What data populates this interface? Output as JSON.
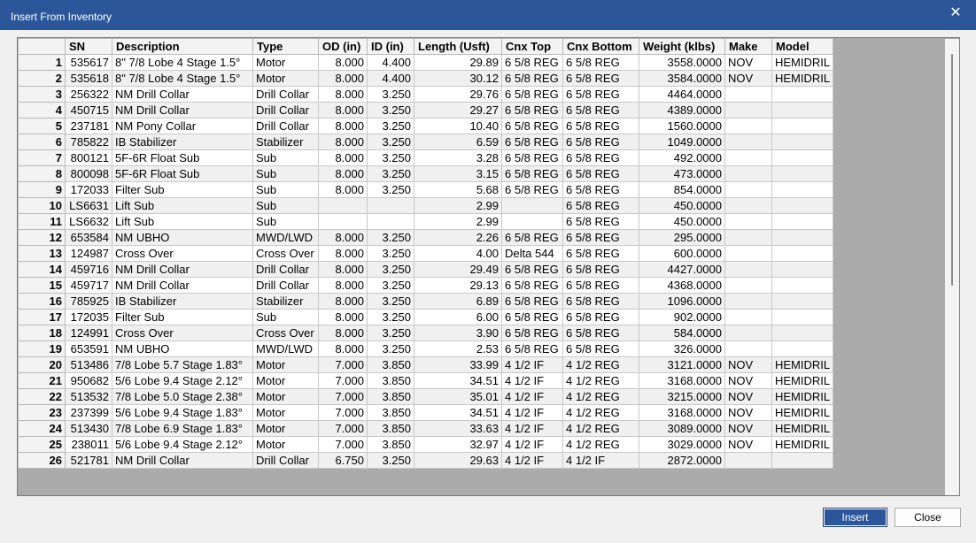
{
  "window": {
    "title": "Insert From Inventory"
  },
  "columns": [
    "SN",
    "Description",
    "Type",
    "OD (in)",
    "ID (in)",
    "Length (Usft)",
    "Cnx Top",
    "Cnx Bottom",
    "Weight (klbs)",
    "Make",
    "Model"
  ],
  "rows": [
    {
      "n": "1",
      "sn": "535617",
      "desc": "8\" 7/8 Lobe 4 Stage 1.5°",
      "type": "Motor",
      "od": "8.000",
      "id": "4.400",
      "len": "29.89",
      "top": "6 5/8 REG",
      "bot": "6 5/8 REG",
      "wt": "3558.0000",
      "make": "NOV",
      "model": "HEMIDRIL"
    },
    {
      "n": "2",
      "sn": "535618",
      "desc": "8\" 7/8 Lobe 4 Stage 1.5°",
      "type": "Motor",
      "od": "8.000",
      "id": "4.400",
      "len": "30.12",
      "top": "6 5/8 REG",
      "bot": "6 5/8 REG",
      "wt": "3584.0000",
      "make": "NOV",
      "model": "HEMIDRIL"
    },
    {
      "n": "3",
      "sn": "256322",
      "desc": "NM Drill Collar",
      "type": "Drill Collar",
      "od": "8.000",
      "id": "3.250",
      "len": "29.76",
      "top": "6 5/8 REG",
      "bot": "6 5/8 REG",
      "wt": "4464.0000",
      "make": "",
      "model": ""
    },
    {
      "n": "4",
      "sn": "450715",
      "desc": "NM Drill Collar",
      "type": "Drill Collar",
      "od": "8.000",
      "id": "3.250",
      "len": "29.27",
      "top": "6 5/8 REG",
      "bot": "6 5/8 REG",
      "wt": "4389.0000",
      "make": "",
      "model": ""
    },
    {
      "n": "5",
      "sn": "237181",
      "desc": "NM Pony Collar",
      "type": "Drill Collar",
      "od": "8.000",
      "id": "3.250",
      "len": "10.40",
      "top": "6 5/8 REG",
      "bot": "6 5/8 REG",
      "wt": "1560.0000",
      "make": "",
      "model": ""
    },
    {
      "n": "6",
      "sn": "785822",
      "desc": "IB Stabilizer",
      "type": "Stabilizer",
      "od": "8.000",
      "id": "3.250",
      "len": "6.59",
      "top": "6 5/8 REG",
      "bot": "6 5/8 REG",
      "wt": "1049.0000",
      "make": "",
      "model": ""
    },
    {
      "n": "7",
      "sn": "800121",
      "desc": "5F-6R Float Sub",
      "type": "Sub",
      "od": "8.000",
      "id": "3.250",
      "len": "3.28",
      "top": "6 5/8 REG",
      "bot": "6 5/8 REG",
      "wt": "492.0000",
      "make": "",
      "model": ""
    },
    {
      "n": "8",
      "sn": "800098",
      "desc": "5F-6R Float Sub",
      "type": "Sub",
      "od": "8.000",
      "id": "3.250",
      "len": "3.15",
      "top": "6 5/8 REG",
      "bot": "6 5/8 REG",
      "wt": "473.0000",
      "make": "",
      "model": ""
    },
    {
      "n": "9",
      "sn": "172033",
      "desc": "Filter Sub",
      "type": "Sub",
      "od": "8.000",
      "id": "3.250",
      "len": "5.68",
      "top": "6 5/8 REG",
      "bot": "6 5/8 REG",
      "wt": "854.0000",
      "make": "",
      "model": ""
    },
    {
      "n": "10",
      "sn": "LS6631",
      "desc": "Lift Sub",
      "type": "Sub",
      "od": "",
      "id": "",
      "len": "2.99",
      "top": "",
      "bot": "6 5/8 REG",
      "wt": "450.0000",
      "make": "",
      "model": ""
    },
    {
      "n": "11",
      "sn": "LS6632",
      "desc": "Lift Sub",
      "type": "Sub",
      "od": "",
      "id": "",
      "len": "2.99",
      "top": "",
      "bot": "6 5/8 REG",
      "wt": "450.0000",
      "make": "",
      "model": ""
    },
    {
      "n": "12",
      "sn": "653584",
      "desc": "NM UBHO",
      "type": "MWD/LWD",
      "od": "8.000",
      "id": "3.250",
      "len": "2.26",
      "top": "6 5/8 REG",
      "bot": "6 5/8 REG",
      "wt": "295.0000",
      "make": "",
      "model": ""
    },
    {
      "n": "13",
      "sn": "124987",
      "desc": "Cross Over",
      "type": "Cross Over",
      "od": "8.000",
      "id": "3.250",
      "len": "4.00",
      "top": "Delta 544",
      "bot": "6 5/8 REG",
      "wt": "600.0000",
      "make": "",
      "model": ""
    },
    {
      "n": "14",
      "sn": "459716",
      "desc": "NM Drill Collar",
      "type": "Drill Collar",
      "od": "8.000",
      "id": "3.250",
      "len": "29.49",
      "top": "6 5/8 REG",
      "bot": "6 5/8 REG",
      "wt": "4427.0000",
      "make": "",
      "model": ""
    },
    {
      "n": "15",
      "sn": "459717",
      "desc": "NM Drill Collar",
      "type": "Drill Collar",
      "od": "8.000",
      "id": "3.250",
      "len": "29.13",
      "top": "6 5/8 REG",
      "bot": "6 5/8 REG",
      "wt": "4368.0000",
      "make": "",
      "model": ""
    },
    {
      "n": "16",
      "sn": "785925",
      "desc": "IB Stabilizer",
      "type": "Stabilizer",
      "od": "8.000",
      "id": "3.250",
      "len": "6.89",
      "top": "6 5/8 REG",
      "bot": "6 5/8 REG",
      "wt": "1096.0000",
      "make": "",
      "model": ""
    },
    {
      "n": "17",
      "sn": "172035",
      "desc": "Filter Sub",
      "type": "Sub",
      "od": "8.000",
      "id": "3.250",
      "len": "6.00",
      "top": "6 5/8 REG",
      "bot": "6 5/8 REG",
      "wt": "902.0000",
      "make": "",
      "model": ""
    },
    {
      "n": "18",
      "sn": "124991",
      "desc": "Cross Over",
      "type": "Cross Over",
      "od": "8.000",
      "id": "3.250",
      "len": "3.90",
      "top": "6 5/8 REG",
      "bot": "6 5/8 REG",
      "wt": "584.0000",
      "make": "",
      "model": ""
    },
    {
      "n": "19",
      "sn": "653591",
      "desc": "NM UBHO",
      "type": "MWD/LWD",
      "od": "8.000",
      "id": "3.250",
      "len": "2.53",
      "top": "6 5/8 REG",
      "bot": "6 5/8 REG",
      "wt": "326.0000",
      "make": "",
      "model": ""
    },
    {
      "n": "20",
      "sn": "513486",
      "desc": "7/8 Lobe 5.7 Stage 1.83°",
      "type": "Motor",
      "od": "7.000",
      "id": "3.850",
      "len": "33.99",
      "top": "4 1/2 IF",
      "bot": "4 1/2 REG",
      "wt": "3121.0000",
      "make": "NOV",
      "model": "HEMIDRIL"
    },
    {
      "n": "21",
      "sn": "950682",
      "desc": "5/6 Lobe 9.4 Stage 2.12°",
      "type": "Motor",
      "od": "7.000",
      "id": "3.850",
      "len": "34.51",
      "top": "4 1/2 IF",
      "bot": "4 1/2 REG",
      "wt": "3168.0000",
      "make": "NOV",
      "model": "HEMIDRIL"
    },
    {
      "n": "22",
      "sn": "513532",
      "desc": "7/8 Lobe 5.0 Stage 2.38°",
      "type": "Motor",
      "od": "7.000",
      "id": "3.850",
      "len": "35.01",
      "top": "4 1/2 IF",
      "bot": "4 1/2 REG",
      "wt": "3215.0000",
      "make": "NOV",
      "model": "HEMIDRIL"
    },
    {
      "n": "23",
      "sn": "237399",
      "desc": "5/6 Lobe 9.4 Stage 1.83°",
      "type": "Motor",
      "od": "7.000",
      "id": "3.850",
      "len": "34.51",
      "top": "4 1/2 IF",
      "bot": "4 1/2 REG",
      "wt": "3168.0000",
      "make": "NOV",
      "model": "HEMIDRIL"
    },
    {
      "n": "24",
      "sn": "513430",
      "desc": "7/8  Lobe 6.9 Stage 1.83°",
      "type": "Motor",
      "od": "7.000",
      "id": "3.850",
      "len": "33.63",
      "top": "4 1/2 IF",
      "bot": "4 1/2 REG",
      "wt": "3089.0000",
      "make": "NOV",
      "model": "HEMIDRIL"
    },
    {
      "n": "25",
      "sn": "238011",
      "desc": "5/6 Lobe 9.4 Stage 2.12°",
      "type": "Motor",
      "od": "7.000",
      "id": "3.850",
      "len": "32.97",
      "top": "4 1/2 IF",
      "bot": "4 1/2 REG",
      "wt": "3029.0000",
      "make": "NOV",
      "model": "HEMIDRIL"
    },
    {
      "n": "26",
      "sn": "521781",
      "desc": "NM Drill Collar",
      "type": "Drill Collar",
      "od": "6.750",
      "id": "3.250",
      "len": "29.63",
      "top": "4 1/2 IF",
      "bot": "4 1/2 IF",
      "wt": "2872.0000",
      "make": "",
      "model": ""
    }
  ],
  "buttons": {
    "insert": "Insert",
    "close": "Close"
  },
  "icons": {
    "close": "close-icon"
  },
  "colors": {
    "titlebar": "#2b579a",
    "primary_button": "#2b579a"
  }
}
